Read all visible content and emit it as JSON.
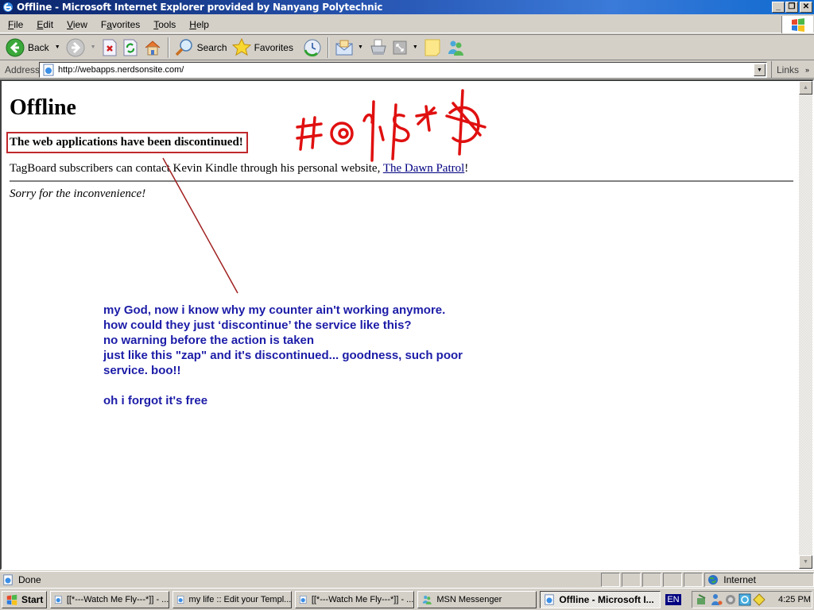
{
  "window": {
    "title": "Offline - Microsoft Internet Explorer provided by Nanyang Polytechnic",
    "minimize": "_",
    "maximize": "❐",
    "close": "✕"
  },
  "menubar": {
    "items": [
      {
        "label": "File",
        "accel": "F"
      },
      {
        "label": "Edit",
        "accel": "E"
      },
      {
        "label": "View",
        "accel": "V"
      },
      {
        "label": "Favorites",
        "accel": "a"
      },
      {
        "label": "Tools",
        "accel": "T"
      },
      {
        "label": "Help",
        "accel": "H"
      }
    ]
  },
  "toolbar": {
    "back_label": "Back",
    "search_label": "Search",
    "favorites_label": "Favorites"
  },
  "address": {
    "label": "Address",
    "url": "http://webapps.nerdsonsite.com/",
    "links_label": "Links",
    "links_chevron": "»"
  },
  "page": {
    "heading": "Offline",
    "notice": "The web applications have been discontinued!",
    "tagline_text": "TagBoard subscribers can contact Kevin Kindle through his personal website, ",
    "tagline_link": "The Dawn Patrol",
    "tagline_end": "!",
    "sorry": "Sorry for the inconvenience!"
  },
  "annotation": {
    "scribble": "#@%$*@",
    "lines": [
      "my God, now i know why my counter ain't working anymore.",
      "how could they just ‘discontinue’ the service like this?",
      "no warning before the action is taken",
      "just like this \"zap\" and it's discontinued... goodness, such poor",
      "service. boo!!",
      "",
      "oh i forgot it's free"
    ],
    "color": "#1c1ca8",
    "mark_color": "#e01010"
  },
  "statusbar": {
    "status": "Done",
    "zone": "Internet"
  },
  "taskbar": {
    "start_label": "Start",
    "tasks": [
      {
        "label": "[[*---Watch Me Fly---*]] - ...",
        "active": false
      },
      {
        "label": "my life :: Edit your Templ...",
        "active": false
      },
      {
        "label": "[[*---Watch Me Fly---*]] - ...",
        "active": false
      },
      {
        "label": "MSN Messenger",
        "active": false
      },
      {
        "label": "Offline - Microsoft I...",
        "active": true
      }
    ],
    "language": "EN",
    "clock": "4:25 PM"
  }
}
